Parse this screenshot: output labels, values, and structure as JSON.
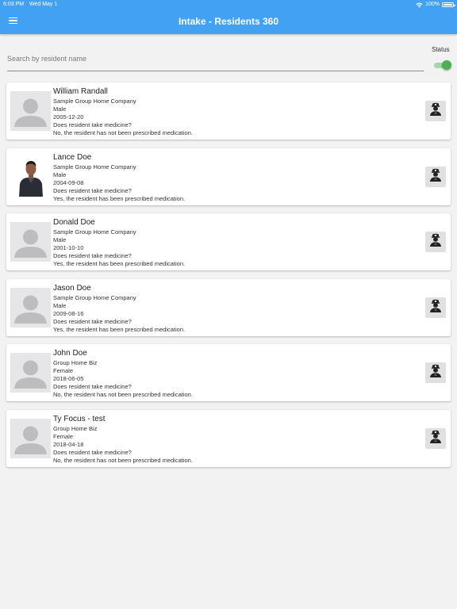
{
  "status_bar": {
    "time": "6:03 PM",
    "date": "Wed May 1",
    "battery": "100%"
  },
  "header": {
    "title": "Intake - Residents 360"
  },
  "search": {
    "placeholder": "Search by resident name",
    "value": ""
  },
  "filter": {
    "status_label": "Status",
    "status_on": true
  },
  "colors": {
    "appbar": "#42a1f3",
    "toggle": "#4caf50",
    "background": "#f2f2f2"
  },
  "residents": [
    {
      "name": "William Randall",
      "company": "Sample Group Home Company",
      "gender": "Male",
      "dob": "2005-12-20",
      "question": "Does resident take medicine?",
      "answer": "No, the resident has not been prescribed medication.",
      "avatar": "placeholder-avatar-icon"
    },
    {
      "name": "Lance Doe",
      "company": "Sample Group Home Company",
      "gender": "Male",
      "dob": "2004-09-08",
      "question": "Does resident take medicine?",
      "answer": "Yes, the resident has been prescribed medication.",
      "avatar": "photo"
    },
    {
      "name": "Donald Doe",
      "company": "Sample Group Home Company",
      "gender": "Male",
      "dob": "2001-10-10",
      "question": "Does resident take medicine?",
      "answer": "Yes, the resident has been prescribed medication.",
      "avatar": "placeholder-avatar-icon"
    },
    {
      "name": "Jason Doe",
      "company": "Sample Group Home Company",
      "gender": "Male",
      "dob": "2009-08-16",
      "question": "Does resident take medicine?",
      "answer": "Yes, the resident has been prescribed medication.",
      "avatar": "placeholder-avatar-icon"
    },
    {
      "name": "John Doe",
      "company": "Group Home Biz",
      "gender": "Female",
      "dob": "2018-06-05",
      "question": "Does resident take medicine?",
      "answer": "No, the resident has not been prescribed medication.",
      "avatar": "placeholder-avatar-icon"
    },
    {
      "name": "Ty Focus - test",
      "company": "Group Home Biz",
      "gender": "Female",
      "dob": "2018-04-18",
      "question": "Does resident take medicine?",
      "answer": "No, the resident has not been prescribed medication.",
      "avatar": "placeholder-avatar-icon"
    }
  ]
}
